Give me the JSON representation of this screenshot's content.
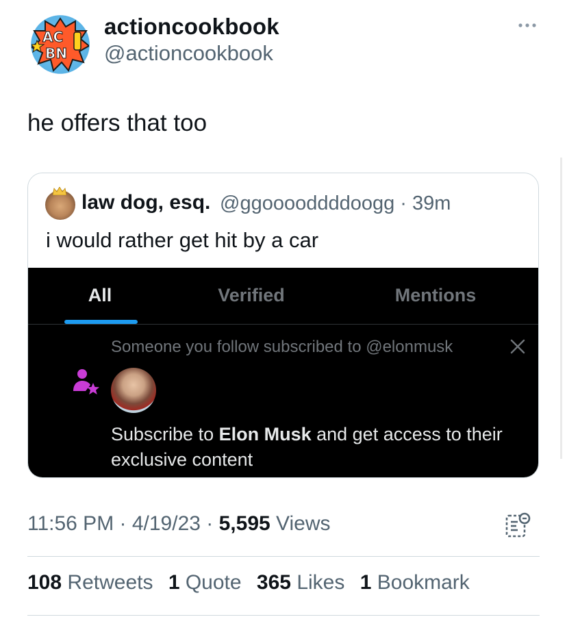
{
  "author": {
    "display_name": "actioncookbook",
    "handle": "@actioncookbook",
    "avatar_text": [
      "AC",
      "BN"
    ]
  },
  "tweet": {
    "text": "he offers that too"
  },
  "quote": {
    "display_name": "law dog, esq.",
    "handle_time": "@ggooooddddoogg · 39m",
    "text": "i would rather get hit by a car",
    "tabs": [
      {
        "label": "All",
        "selected": true
      },
      {
        "label": "Verified",
        "selected": false
      },
      {
        "label": "Mentions",
        "selected": false
      }
    ],
    "notification": {
      "header": "Someone you follow subscribed to @elonmusk",
      "body_prefix": "Subscribe to ",
      "body_name": "Elon Musk",
      "body_suffix": " and get access to their exclusive content"
    }
  },
  "meta": {
    "timestamp": "11:56 PM · 4/19/23 · ",
    "views_count": "5,595",
    "views_label": " Views"
  },
  "stats": [
    {
      "count": "108",
      "label": "Retweets"
    },
    {
      "count": "1",
      "label": "Quote"
    },
    {
      "count": "365",
      "label": "Likes"
    },
    {
      "count": "1",
      "label": "Bookmark"
    }
  ],
  "colors": {
    "accent": "#1d9bf0",
    "subscribe_icon": "#c93cd6",
    "secondary_text": "#536471"
  }
}
